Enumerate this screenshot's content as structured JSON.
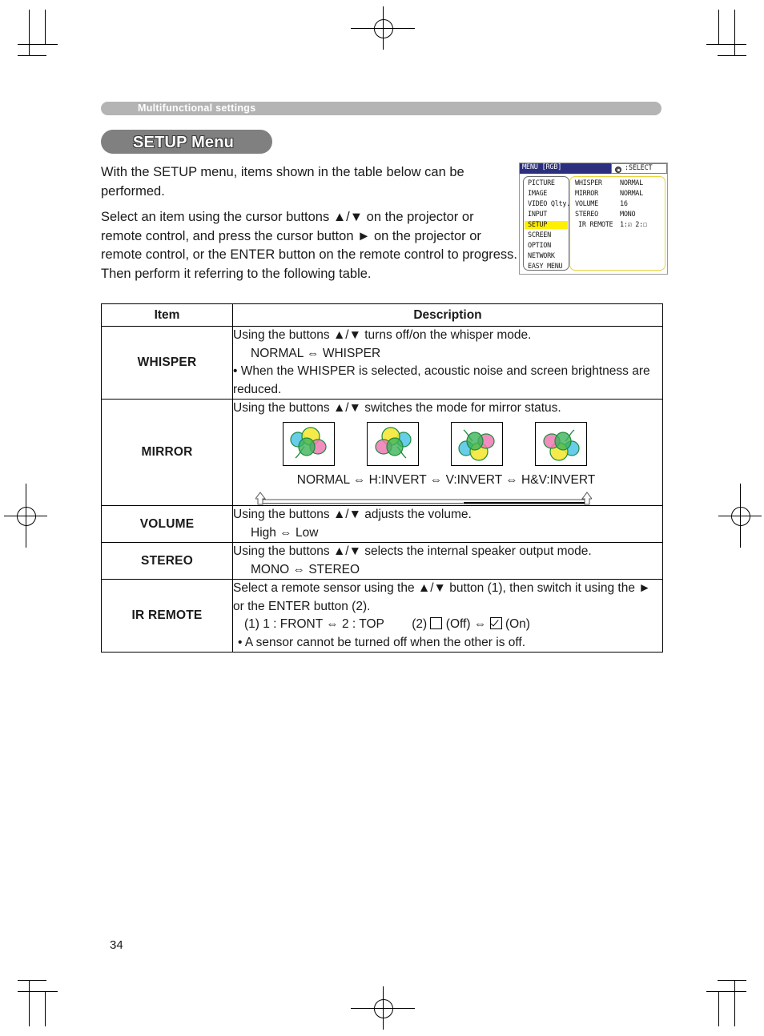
{
  "page": {
    "number": "34",
    "banner_label": "Multifunctional settings",
    "section_title": "SETUP Menu"
  },
  "intro": {
    "paragraph1": "With the SETUP menu, items shown in the table below can be performed.",
    "paragraph2": "Select an item using the cursor buttons ▲/▼ on the projector or remote control, and press the cursor button ► on the projector or remote control, or the ENTER button on the remote control to progress. Then perform it referring to the following table."
  },
  "osd": {
    "title": "MENU [RGB]",
    "select_label": ":SELECT",
    "select_icon": "dpad-icon",
    "menu_items": [
      "PICTURE",
      "IMAGE",
      "VIDEO Qlty.",
      "INPUT",
      "SETUP",
      "SCREEN",
      "OPTION",
      "NETWORK",
      "EASY MENU"
    ],
    "highlighted_item": "SETUP",
    "settings": [
      {
        "name": "WHISPER",
        "value": "NORMAL"
      },
      {
        "name": "MIRROR",
        "value": "NORMAL"
      },
      {
        "name": "VOLUME",
        "value": "16"
      },
      {
        "name": "STEREO",
        "value": "MONO"
      },
      {
        "name": "IR REMOTE",
        "value": "1:☑ 2:☐"
      }
    ],
    "colors": {
      "titlebar": "#2b2f7d",
      "highlight": "#ffef00",
      "frame": "#e8d43c"
    }
  },
  "table": {
    "headers": {
      "item": "Item",
      "description": "Description"
    },
    "rows": [
      {
        "item": "WHISPER",
        "lines": [
          "Using the buttons ▲/▼ turns off/on the whisper mode.",
          "NORMAL ⇔ WHISPER",
          "• When the WHISPER is selected, acoustic noise and screen brightness are reduced."
        ]
      },
      {
        "item": "MIRROR",
        "lines": [
          "Using the buttons ▲/▼ switches the mode for mirror status."
        ],
        "modes": [
          "NORMAL",
          "H:INVERT",
          "V:INVERT",
          "H&V:INVERT"
        ],
        "mode_separator": "⇔",
        "icons": [
          "balloons-normal-icon",
          "balloons-h-invert-icon",
          "balloons-v-invert-icon",
          "balloons-hv-invert-icon"
        ]
      },
      {
        "item": "VOLUME",
        "lines": [
          "Using the buttons ▲/▼ adjusts the volume.",
          "High ⇔ Low"
        ]
      },
      {
        "item": "STEREO",
        "lines": [
          "Using the buttons ▲/▼ selects the internal speaker output mode.",
          "MONO ⇔ STEREO"
        ]
      },
      {
        "item": "IR REMOTE",
        "lines": [
          "Select a remote sensor using the ▲/▼ button (1), then switch it using the ► or the ENTER button (2).",
          "• A sensor cannot be turned off when the other is off."
        ],
        "option_line": {
          "part1": "(1) 1 : FRONT ⇔  2 : TOP",
          "part2_prefix": "(2)",
          "off_label": "(Off)",
          "separator": "⇔",
          "on_label": "(On)"
        }
      }
    ]
  }
}
